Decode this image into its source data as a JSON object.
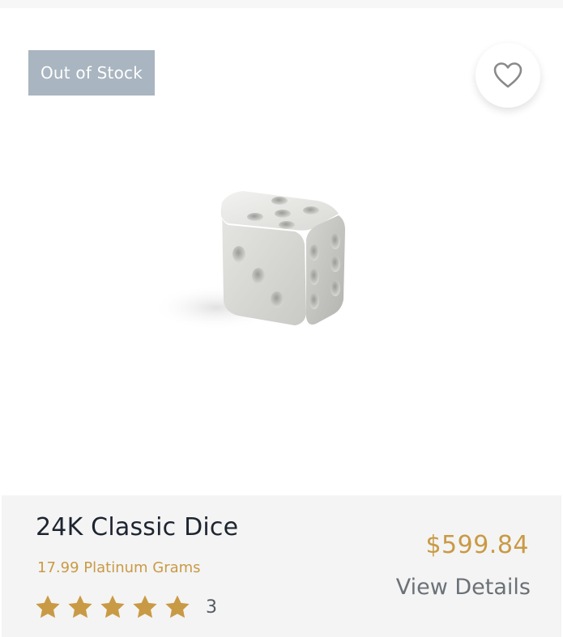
{
  "badge": {
    "label": "Out of Stock",
    "color": "#a9b5c0"
  },
  "wishlist": {
    "icon": "heart-outline-icon"
  },
  "product": {
    "image": "silver-dice-image",
    "name": "24K Classic Dice",
    "weight": "17.99 Platinum Grams",
    "price": "$599.84",
    "rating": {
      "stars": 5,
      "max_stars": 5,
      "count": "3"
    },
    "details_label": "View Details"
  },
  "colors": {
    "accent_gold": "#c99a45",
    "panel_bg": "#f4f4f4",
    "title": "#1e2530"
  }
}
